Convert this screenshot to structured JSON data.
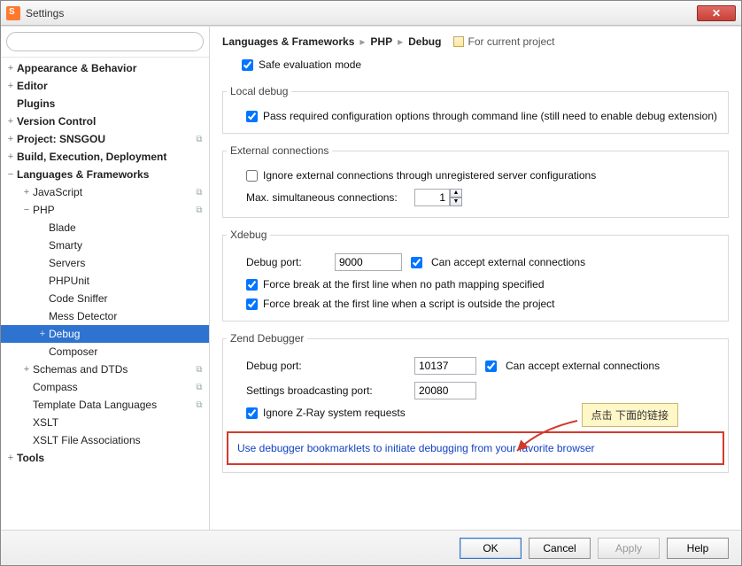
{
  "window": {
    "title": "Settings"
  },
  "search": {
    "placeholder": ""
  },
  "tree": [
    {
      "label": "Appearance & Behavior",
      "exp": "+",
      "top": true,
      "ind": 0,
      "inter": true
    },
    {
      "label": "Editor",
      "exp": "+",
      "top": true,
      "ind": 0,
      "inter": true
    },
    {
      "label": "Plugins",
      "exp": "",
      "top": true,
      "ind": 0,
      "inter": true
    },
    {
      "label": "Version Control",
      "exp": "+",
      "top": true,
      "ind": 0,
      "inter": true
    },
    {
      "label": "Project: SNSGOU",
      "exp": "+",
      "top": true,
      "ind": 0,
      "inter": true,
      "badge": "⧉"
    },
    {
      "label": "Build, Execution, Deployment",
      "exp": "+",
      "top": true,
      "ind": 0,
      "inter": true
    },
    {
      "label": "Languages & Frameworks",
      "exp": "−",
      "top": true,
      "ind": 0,
      "inter": true
    },
    {
      "label": "JavaScript",
      "exp": "+",
      "ind": 1,
      "inter": true,
      "badge": "⧉"
    },
    {
      "label": "PHP",
      "exp": "−",
      "ind": 1,
      "inter": true,
      "badge": "⧉"
    },
    {
      "label": "Blade",
      "ind": 2,
      "inter": true
    },
    {
      "label": "Smarty",
      "ind": 2,
      "inter": true
    },
    {
      "label": "Servers",
      "ind": 2,
      "inter": true
    },
    {
      "label": "PHPUnit",
      "ind": 2,
      "inter": true
    },
    {
      "label": "Code Sniffer",
      "ind": 2,
      "inter": true
    },
    {
      "label": "Mess Detector",
      "ind": 2,
      "inter": true
    },
    {
      "label": "Debug",
      "exp": "+",
      "ind": 2,
      "inter": true,
      "sel": true
    },
    {
      "label": "Composer",
      "ind": 2,
      "inter": true
    },
    {
      "label": "Schemas and DTDs",
      "exp": "+",
      "ind": 1,
      "inter": true,
      "badge": "⧉"
    },
    {
      "label": "Compass",
      "ind": 1,
      "inter": true,
      "badge": "⧉"
    },
    {
      "label": "Template Data Languages",
      "ind": 1,
      "inter": true,
      "badge": "⧉"
    },
    {
      "label": "XSLT",
      "ind": 1,
      "inter": true
    },
    {
      "label": "XSLT File Associations",
      "ind": 1,
      "inter": true
    },
    {
      "label": "Tools",
      "exp": "+",
      "top": true,
      "ind": 0,
      "inter": true
    }
  ],
  "breadcrumb": {
    "a": "Languages & Frameworks",
    "b": "PHP",
    "c": "Debug",
    "proj": "For current project"
  },
  "general": {
    "safe_eval": "Safe evaluation mode"
  },
  "local_debug": {
    "legend": "Local debug",
    "pass_conf": "Pass required configuration options through command line (still need to enable debug extension)"
  },
  "external": {
    "legend": "External connections",
    "ignore": "Ignore external connections through unregistered server configurations",
    "max_label": "Max. simultaneous connections:",
    "max_value": "1"
  },
  "xdebug": {
    "legend": "Xdebug",
    "port_label": "Debug port:",
    "port_value": "9000",
    "accept": "Can accept external connections",
    "force_nopath": "Force break at the first line when no path mapping specified",
    "force_outside": "Force break at the first line when a script is outside the project"
  },
  "zend": {
    "legend": "Zend Debugger",
    "port_label": "Debug port:",
    "port_value": "10137",
    "accept": "Can accept external connections",
    "bcast_label": "Settings broadcasting port:",
    "bcast_value": "20080",
    "zray": "Ignore Z-Ray system requests",
    "link": "Use debugger bookmarklets to initiate debugging from your favorite browser",
    "note": "点击 下面的链接"
  },
  "footer": {
    "ok": "OK",
    "cancel": "Cancel",
    "apply": "Apply",
    "help": "Help"
  }
}
